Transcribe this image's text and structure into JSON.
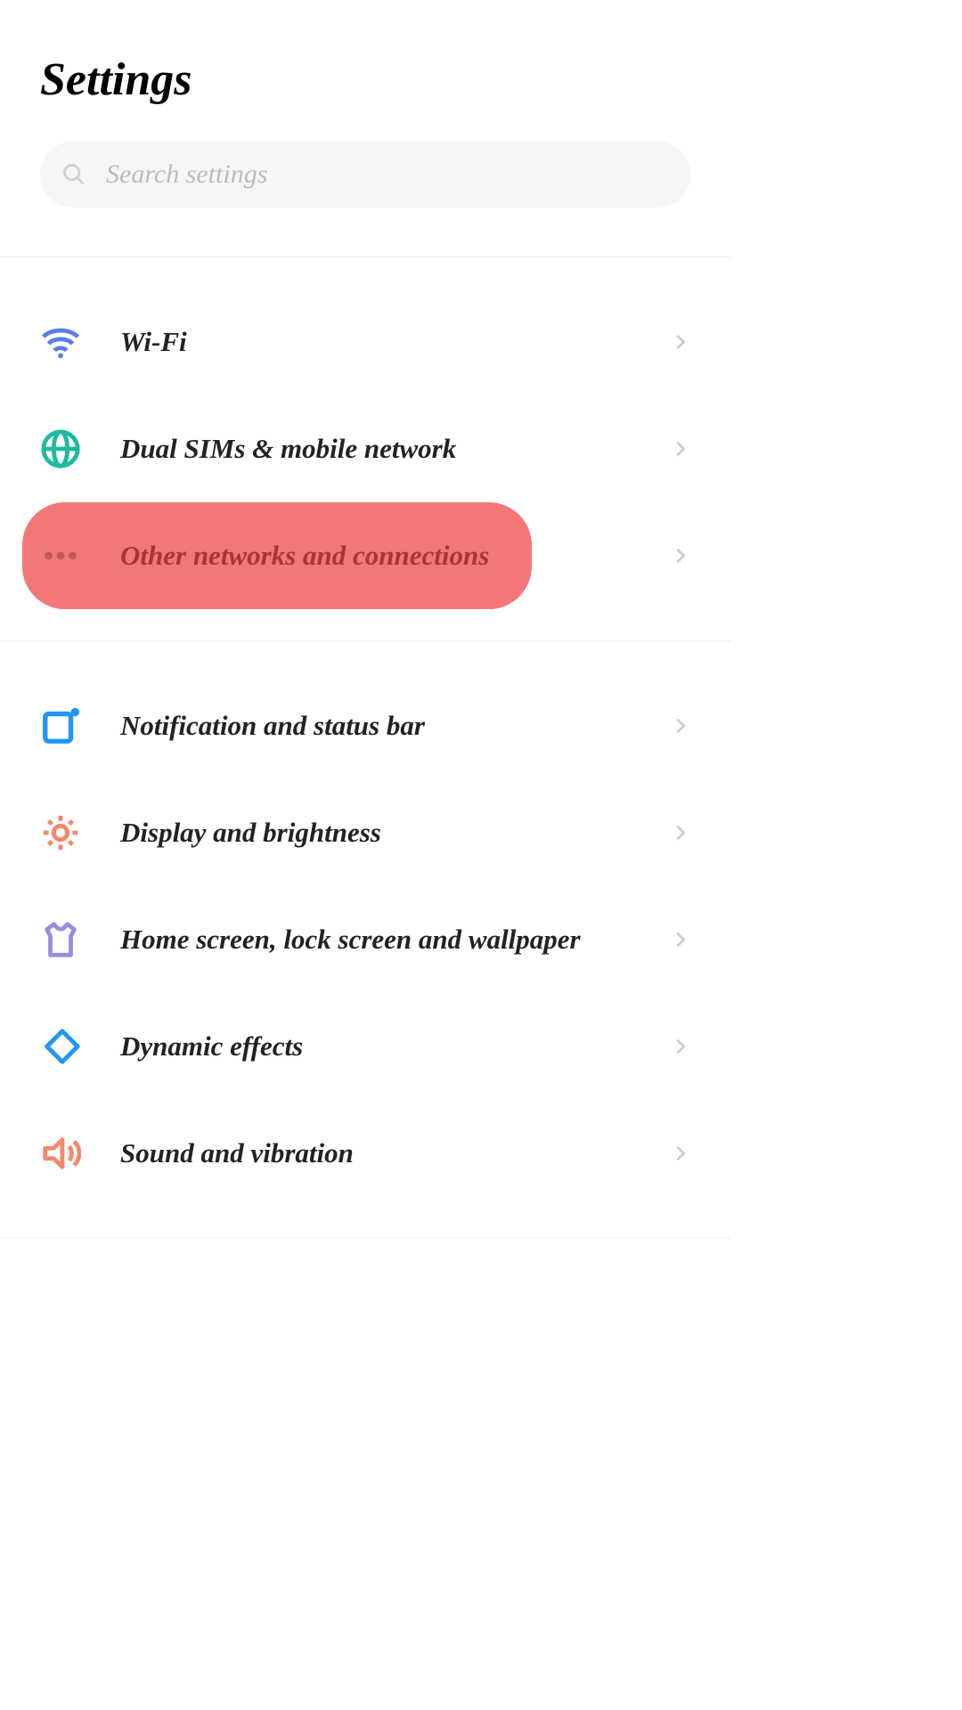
{
  "title": "Settings",
  "search": {
    "placeholder": "Search settings"
  },
  "groups": [
    {
      "items": [
        {
          "label": "Wi-Fi",
          "icon": "wifi",
          "highlighted": false
        },
        {
          "label": "Dual SIMs & mobile network",
          "icon": "globe",
          "highlighted": false
        },
        {
          "label": "Other networks and connections",
          "icon": "dots",
          "highlighted": true
        }
      ]
    },
    {
      "items": [
        {
          "label": "Notification and status bar",
          "icon": "notification",
          "highlighted": false
        },
        {
          "label": "Display and brightness",
          "icon": "brightness",
          "highlighted": false
        },
        {
          "label": "Home screen, lock screen and wallpaper",
          "icon": "shirt",
          "highlighted": false
        },
        {
          "label": "Dynamic effects",
          "icon": "diamond",
          "highlighted": false
        },
        {
          "label": "Sound and vibration",
          "icon": "sound",
          "highlighted": false
        }
      ]
    }
  ]
}
